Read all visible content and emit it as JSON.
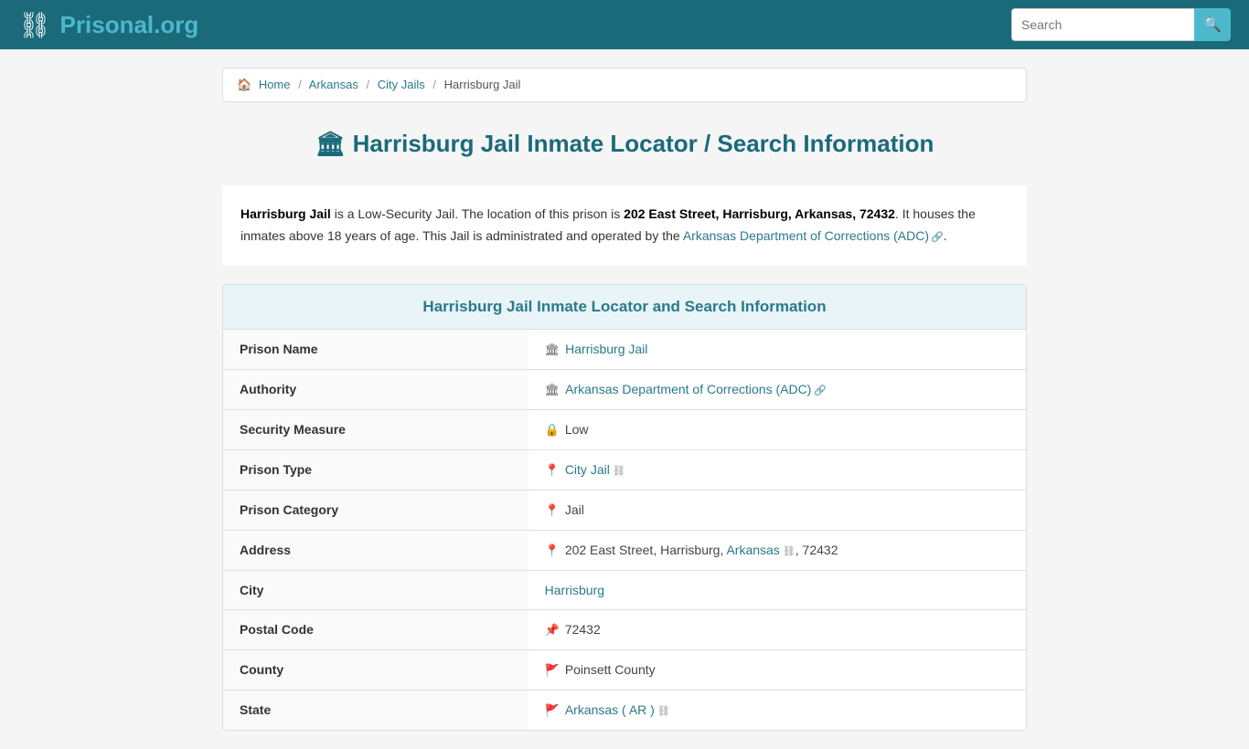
{
  "header": {
    "logo_text_main": "Prisonal",
    "logo_text_accent": ".org",
    "search_placeholder": "Search"
  },
  "breadcrumb": {
    "home": "Home",
    "arkansas": "Arkansas",
    "city_jails": "City Jails",
    "current": "Harrisburg Jail"
  },
  "page": {
    "title": "Harrisburg Jail Inmate Locator / Search Information",
    "description_part1": " is a Low-Security Jail. The location of this prison is ",
    "description_bold1": "Harrisburg Jail",
    "description_address": "202 East Street, Harrisburg, Arkansas, 72432",
    "description_part2": ". It houses the inmates above 18 years of age. This Jail is administrated and operated by the ",
    "description_link": "Arkansas Department of Corrections (ADC)",
    "description_end": ".",
    "section_header": "Harrisburg Jail Inmate Locator and Search Information"
  },
  "table": {
    "rows": [
      {
        "label": "Prison Name",
        "icon": "🏛",
        "value": "Harrisburg Jail",
        "link": true,
        "link_text": "Harrisburg Jail"
      },
      {
        "label": "Authority",
        "icon": "🏛",
        "value": "Arkansas Department of Corrections (ADC)",
        "link": true,
        "link_text": "Arkansas Department of Corrections (ADC)",
        "ext": true
      },
      {
        "label": "Security Measure",
        "icon": "🔒",
        "value": "Low",
        "link": false
      },
      {
        "label": "Prison Type",
        "icon": "📍",
        "value": "City Jail",
        "link": true,
        "link_text": "City Jail",
        "chain": true
      },
      {
        "label": "Prison Category",
        "icon": "📍",
        "value": "Jail",
        "link": false
      },
      {
        "label": "Address",
        "icon": "📍",
        "value_prefix": "202 East Street, Harrisburg, ",
        "value_link": "Arkansas",
        "value_suffix": ", 72432",
        "has_parts": true
      },
      {
        "label": "City",
        "icon": "",
        "value": "Harrisburg",
        "link": true,
        "link_text": "Harrisburg"
      },
      {
        "label": "Postal Code",
        "icon": "📌",
        "value": "72432",
        "link": false
      },
      {
        "label": "County",
        "icon": "🚩",
        "value": "Poinsett County",
        "link": false
      },
      {
        "label": "State",
        "icon": "🚩",
        "value": "Arkansas ( AR )",
        "link": true,
        "link_text": "Arkansas ( AR )",
        "chain": true
      }
    ]
  }
}
